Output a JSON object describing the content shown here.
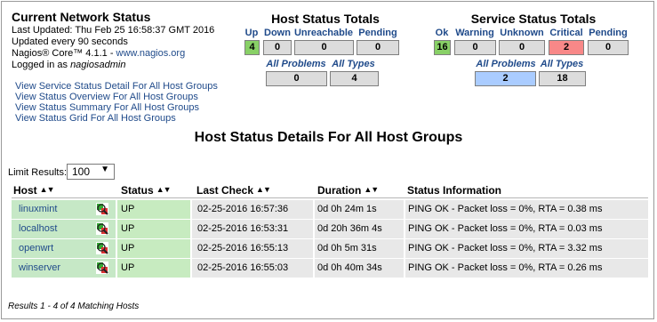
{
  "status_panel": {
    "title": "Current Network Status",
    "last_updated": "Last Updated: Thu Feb 25 16:58:37 GMT 2016",
    "update_interval": "Updated every 90 seconds",
    "version_prefix": "Nagios® Core™ 4.1.1 - ",
    "version_link": "www.nagios.org",
    "logged_in_prefix": "Logged in as ",
    "logged_in_user": "nagiosadmin",
    "links": [
      "View Service Status Detail For All Host Groups",
      "View Status Overview For All Host Groups",
      "View Status Summary For All Host Groups",
      "View Status Grid For All Host Groups"
    ]
  },
  "host_totals": {
    "title": "Host Status Totals",
    "labels": [
      "Up",
      "Down",
      "Unreachable",
      "Pending"
    ],
    "values": [
      "4",
      "0",
      "0",
      "0"
    ],
    "all_problems_label": "All Problems",
    "all_types_label": "All Types",
    "all_problems": "0",
    "all_types": "4"
  },
  "service_totals": {
    "title": "Service Status Totals",
    "labels": [
      "Ok",
      "Warning",
      "Unknown",
      "Critical",
      "Pending"
    ],
    "values": [
      "16",
      "0",
      "0",
      "2",
      "0"
    ],
    "all_problems_label": "All Problems",
    "all_types_label": "All Types",
    "all_problems": "2",
    "all_types": "18"
  },
  "colors": {
    "ok": "#88d066",
    "critical": "#f88888",
    "problems": "#aaccff",
    "link": "#1f4a8a"
  },
  "details": {
    "title": "Host Status Details For All Host Groups",
    "limit_label": "Limit Results:",
    "limit_value": "100",
    "columns": [
      "Host",
      "Status",
      "Last Check",
      "Duration",
      "Status Information"
    ],
    "rows": [
      {
        "host": "linuxmint",
        "status": "UP",
        "last_check": "02-25-2016 16:57:36",
        "duration": "0d 0h 24m 1s",
        "info": "PING OK - Packet loss = 0%, RTA = 0.38 ms"
      },
      {
        "host": "localhost",
        "status": "UP",
        "last_check": "02-25-2016 16:53:31",
        "duration": "0d 20h 36m 4s",
        "info": "PING OK - Packet loss = 0%, RTA = 0.03 ms"
      },
      {
        "host": "openwrt",
        "status": "UP",
        "last_check": "02-25-2016 16:55:13",
        "duration": "0d 0h 5m 31s",
        "info": "PING OK - Packet loss = 0%, RTA = 3.32 ms"
      },
      {
        "host": "winserver",
        "status": "UP",
        "last_check": "02-25-2016 16:55:03",
        "duration": "0d 0h 40m 34s",
        "info": "PING OK - Packet loss = 0%, RTA = 0.26 ms"
      }
    ],
    "footer": "Results 1 - 4 of 4 Matching Hosts"
  }
}
